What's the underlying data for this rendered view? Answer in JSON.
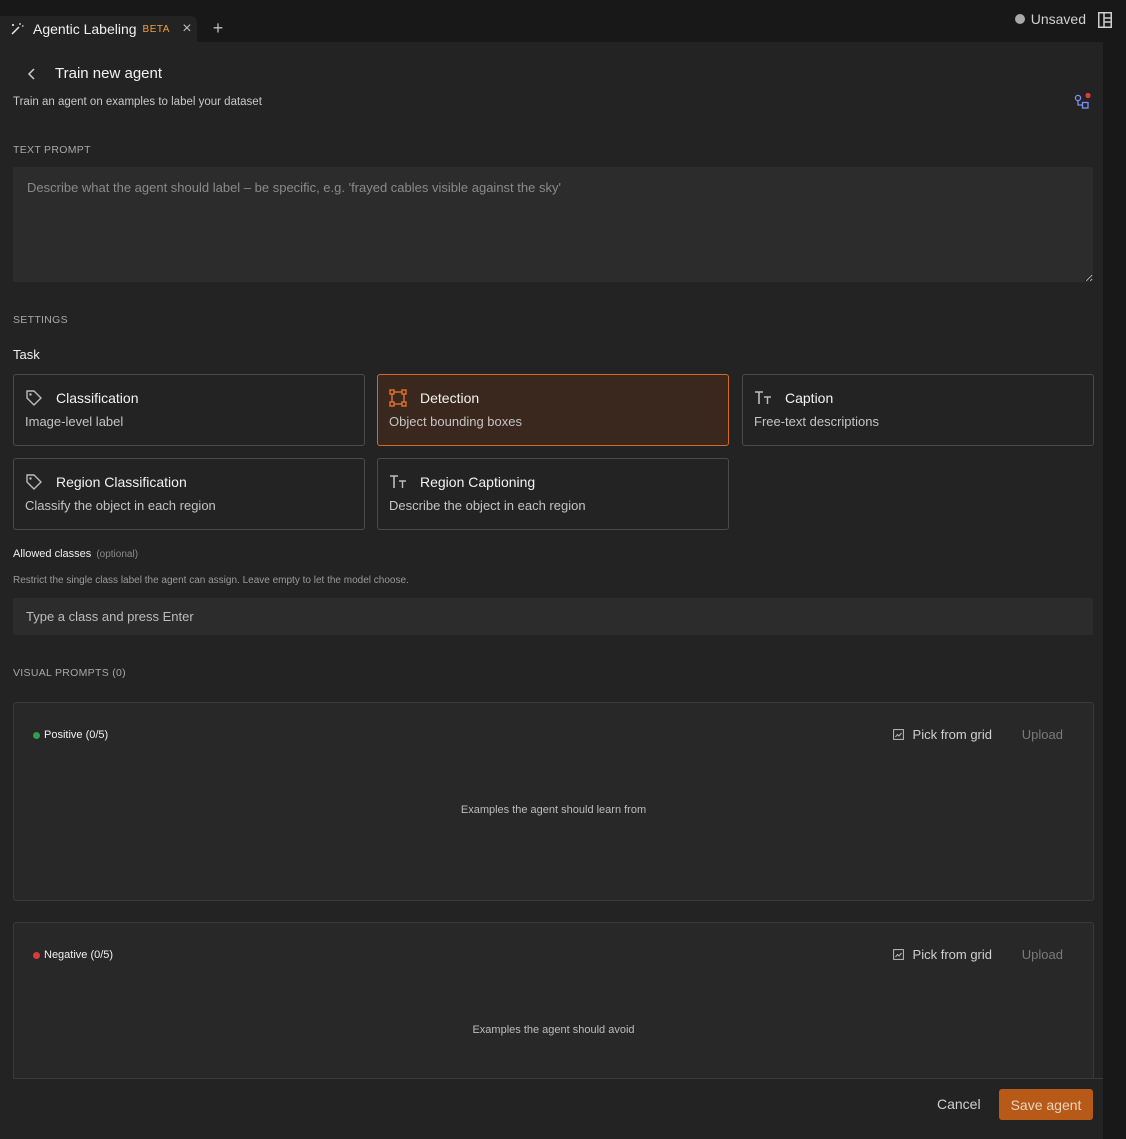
{
  "tab": {
    "title": "Agentic Labeling",
    "badge": "BETA",
    "close": "×",
    "new_tab": "+"
  },
  "status": {
    "label": "Unsaved"
  },
  "header": {
    "title": "Train new agent",
    "subtitle": "Train an agent on examples to label your dataset"
  },
  "text_prompt": {
    "section": "TEXT PROMPT",
    "placeholder": "Describe what the agent should label – be specific, e.g. 'frayed cables visible against the sky'",
    "value": ""
  },
  "settings": {
    "section": "SETTINGS",
    "task_label": "Task",
    "tasks": [
      {
        "name": "Classification",
        "desc": "Image-level label",
        "icon": "tag-icon",
        "selected": false
      },
      {
        "name": "Detection",
        "desc": "Object bounding boxes",
        "icon": "bounding-box-icon",
        "selected": true
      },
      {
        "name": "Caption",
        "desc": "Free-text descriptions",
        "icon": "text-icon",
        "selected": false
      },
      {
        "name": "Region Classification",
        "desc": "Classify the object in each region",
        "icon": "tag-icon",
        "selected": false
      },
      {
        "name": "Region Captioning",
        "desc": "Describe the object in each region",
        "icon": "text-icon",
        "selected": false
      }
    ],
    "allowed_classes": {
      "label": "Allowed classes",
      "optional": "(optional)",
      "help": "Restrict the single class label the agent can assign. Leave empty to let the model choose.",
      "placeholder": "Type a class and press Enter"
    }
  },
  "visual_prompts": {
    "section": "VISUAL PROMPTS (0)",
    "positive": {
      "label": "Positive (0/5)",
      "color": "#2e9e4f",
      "pick": "Pick from grid",
      "upload": "Upload",
      "empty": "Examples the agent should learn from"
    },
    "negative": {
      "label": "Negative (0/5)",
      "color": "#d93a3a",
      "pick": "Pick from grid",
      "upload": "Upload",
      "empty": "Examples the agent should avoid"
    }
  },
  "footer": {
    "cancel": "Cancel",
    "save": "Save agent"
  },
  "colors": {
    "accent": "#d06a26",
    "save_button": "#b85a17",
    "selected_card_bg": "#3a281e"
  }
}
